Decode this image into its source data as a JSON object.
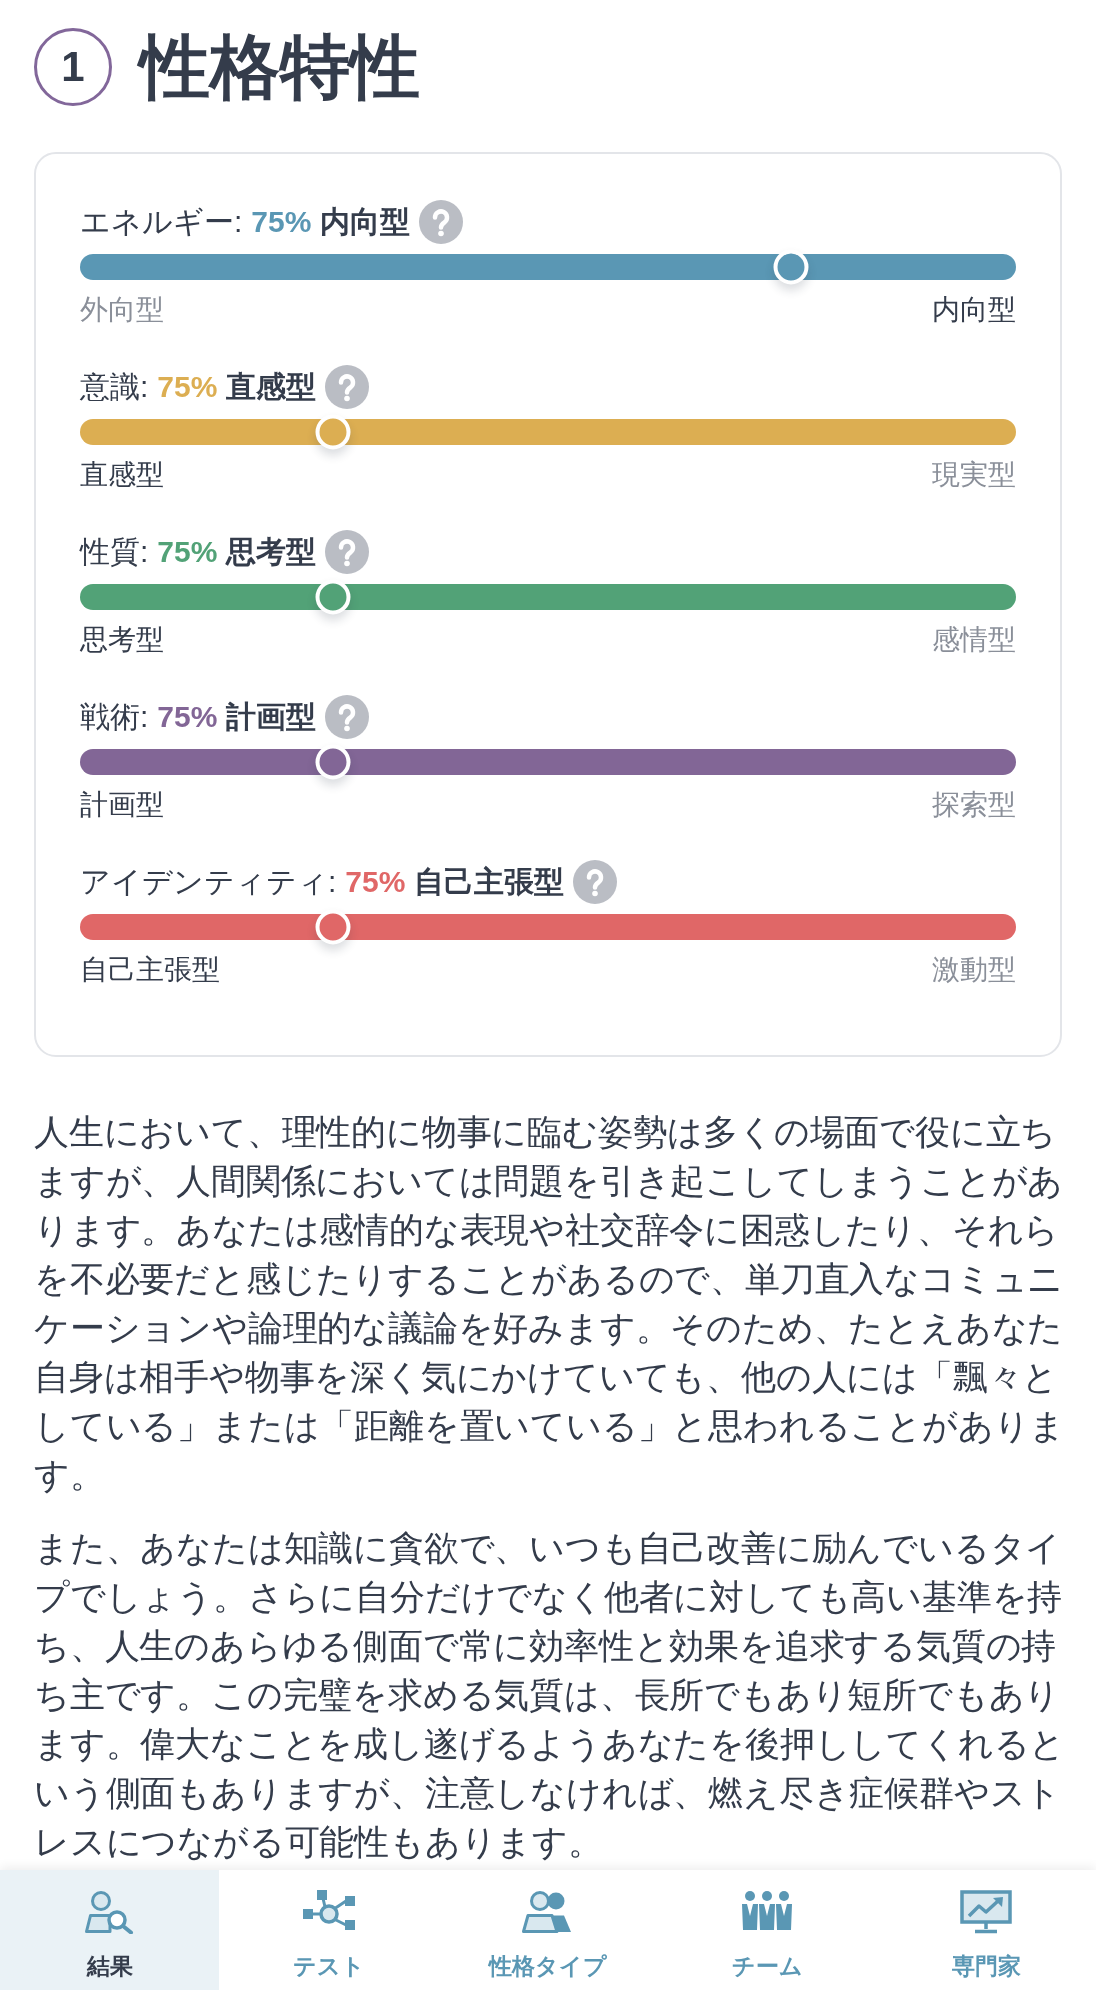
{
  "header": {
    "number": "1",
    "title": "性格特性"
  },
  "traits": [
    {
      "name": "エネルギー:",
      "percent": "75%",
      "type": "内向型",
      "color": "#5a97b4",
      "level": 0.76,
      "left": {
        "label": "外向型",
        "dominant": false
      },
      "right": {
        "label": "内向型",
        "dominant": true
      }
    },
    {
      "name": "意識:",
      "percent": "75%",
      "type": "直感型",
      "color": "#dcae52",
      "level": 0.27,
      "left": {
        "label": "直感型",
        "dominant": true
      },
      "right": {
        "label": "現実型",
        "dominant": false
      }
    },
    {
      "name": "性質:",
      "percent": "75%",
      "type": "思考型",
      "color": "#52a277",
      "level": 0.27,
      "left": {
        "label": "思考型",
        "dominant": true
      },
      "right": {
        "label": "感情型",
        "dominant": false
      }
    },
    {
      "name": "戦術:",
      "percent": "75%",
      "type": "計画型",
      "color": "#826696",
      "level": 0.27,
      "left": {
        "label": "計画型",
        "dominant": true
      },
      "right": {
        "label": "探索型",
        "dominant": false
      }
    },
    {
      "name": "アイデンティティ:",
      "percent": "75%",
      "type": "自己主張型",
      "color": "#e06767",
      "level": 0.27,
      "left": {
        "label": "自己主張型",
        "dominant": true
      },
      "right": {
        "label": "激動型",
        "dominant": false
      }
    }
  ],
  "paragraphs": [
    "人生において、理性的に物事に臨む姿勢は多くの場面で役に立ちますが、人間関係においては問題を引き起こしてしまうことがあります。あなたは感情的な表現や社交辞令に困惑したり、それらを不必要だと感じたりすることがあるので、単刀直入なコミュニケーションや論理的な議論を好みます。そのため、たとえあなた自身は相手や物事を深く気にかけていても、他の人には「飄々としている」または「距離を置いている」と思われることがあります。",
    "また、あなたは知識に貪欲で、いつも自己改善に励んでいるタイプでしょう。さらに自分だけでなく他者に対しても高い基準を持ち、人生のあらゆる側面で常に効率性と効果を追求する気質の持ち主です。この完璧を求める気質は、長所でもあり短所でもあります。偉大なことを成し遂げるようあなたを後押ししてくれるという側面もありますが、注意しなければ、燃え尽き症候群やストレスにつながる可能性もあります。"
  ],
  "nav": [
    {
      "label": "結果",
      "selected": true
    },
    {
      "label": "テスト",
      "selected": false
    },
    {
      "label": "性格タイプ",
      "selected": false
    },
    {
      "label": "チーム",
      "selected": false
    },
    {
      "label": "専門家",
      "selected": false
    }
  ]
}
